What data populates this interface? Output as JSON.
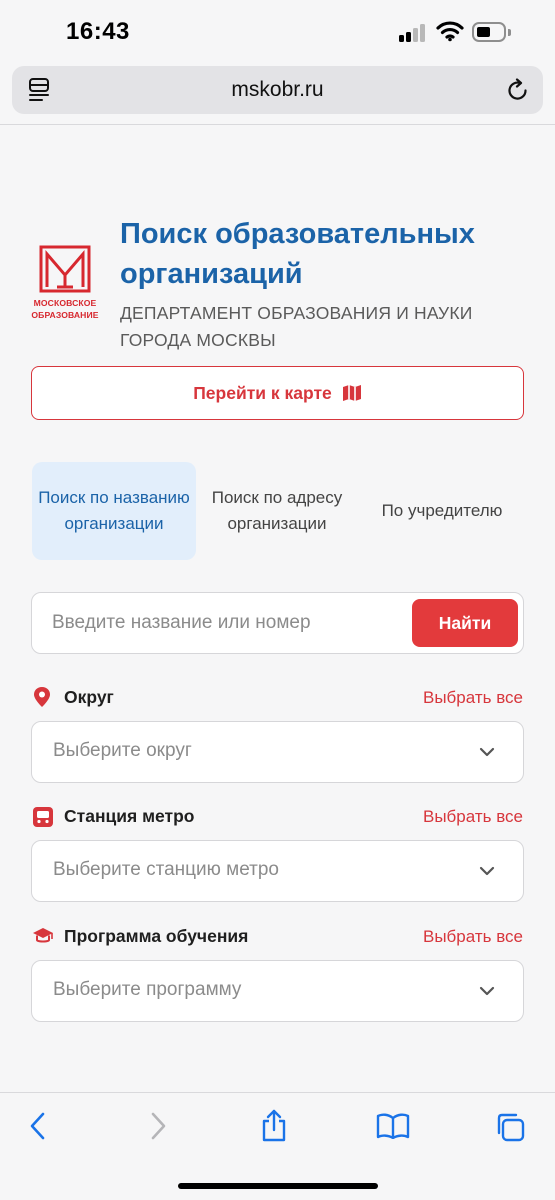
{
  "status_bar": {
    "time": "16:43"
  },
  "browser": {
    "url": "mskobr.ru"
  },
  "header": {
    "logo_line1": "МОСКОВСКОЕ",
    "logo_line2": "ОБРАЗОВАНИЕ",
    "title": "Поиск образовательных организаций",
    "subtitle": "ДЕПАРТАМЕНТ ОБРАЗОВАНИЯ И НАУКИ ГОРОДА МОСКВЫ"
  },
  "map_button": {
    "label": "Перейти к карте",
    "icon": "map-icon"
  },
  "tabs": [
    {
      "label": "Поиск по названию организации",
      "active": true
    },
    {
      "label": "Поиск по адресу организации",
      "active": false
    },
    {
      "label": "По учредителю",
      "active": false
    }
  ],
  "search": {
    "placeholder": "Введите название или номер",
    "value": "",
    "button_label": "Найти"
  },
  "filters": {
    "district": {
      "label": "Округ",
      "select_all": "Выбрать все",
      "placeholder": "Выберите округ",
      "icon": "location-pin-icon"
    },
    "metro": {
      "label": "Станция метро",
      "select_all": "Выбрать все",
      "placeholder": "Выберите станцию метро",
      "icon": "metro-icon"
    },
    "program": {
      "label": "Программа обучения",
      "select_all": "Выбрать все",
      "placeholder": "Выберите программу",
      "icon": "graduation-cap-icon"
    }
  },
  "colors": {
    "brand_red": "#e33a3c",
    "title_blue": "#1b63a8",
    "active_tab_bg": "#e2eefb",
    "ios_blue": "#1a73e8"
  }
}
